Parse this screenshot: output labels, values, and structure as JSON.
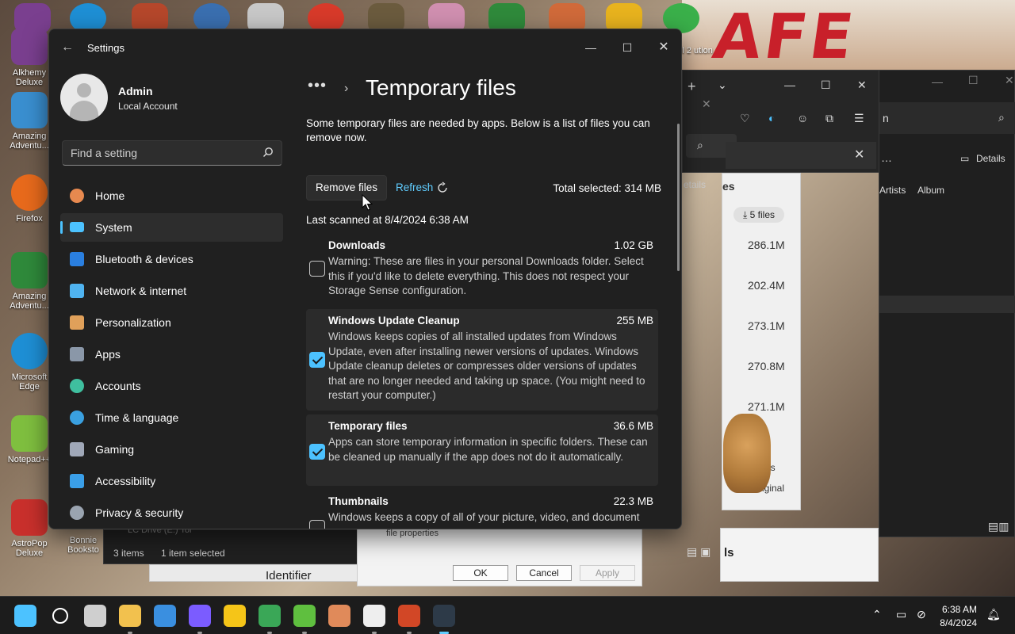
{
  "desktop": {
    "banner_text": "AFE",
    "icons": [
      {
        "label": "Alkhemy Deluxe",
        "color": "#7a3f8f"
      },
      {
        "label": "Amazing Adventu...",
        "color": "#3a8fd0"
      },
      {
        "label": "Firefox",
        "color": "#e86a1c"
      },
      {
        "label": "Amazing Adventu...",
        "color": "#2f8a3b"
      },
      {
        "label": "Microsoft Edge",
        "color": "#1e8fd5"
      },
      {
        "label": "Notepad++",
        "color": "#7fbf3f"
      },
      {
        "label": "AstroPop Deluxe",
        "color": "#c9302c"
      }
    ],
    "top_partial_label": "rball 2 ution"
  },
  "background_windows": {
    "explorer_status_items": "3 items",
    "explorer_status_selected": "1 item selected",
    "explorer_drive_text": "LC Drive (E:) Tol",
    "explorer_left_label": "Bonnie Booksto",
    "identifier_label": "Identifier",
    "file_properties": "file properties",
    "ok_label": "OK",
    "cancel_label": "Cancel",
    "apply_label": "Apply",
    "media_details_label": "Details",
    "media_partial_search": "n",
    "media_artists": "Artists",
    "media_album": "Album",
    "media_files_badge": "5 files",
    "media_sizes": [
      "286.1M",
      "202.4M",
      "273.1M",
      "270.8M",
      "271.1M"
    ],
    "media_partial_es": "es",
    "media_partial_details": "etails",
    "media_partial_original": "iginal",
    "media_partial_ls": "ls"
  },
  "settings": {
    "app_title": "Settings",
    "user": {
      "name": "Admin",
      "type": "Local Account"
    },
    "search_placeholder": "Find a setting",
    "nav": [
      {
        "label": "Home",
        "icon": "home-icon",
        "color": "#e7894f",
        "active": false
      },
      {
        "label": "System",
        "icon": "system-icon",
        "color": "#4cc2ff",
        "active": true
      },
      {
        "label": "Bluetooth & devices",
        "icon": "bluetooth-icon",
        "color": "#2a7fe0",
        "active": false
      },
      {
        "label": "Network & internet",
        "icon": "network-icon",
        "color": "#4fb3f0",
        "active": false
      },
      {
        "label": "Personalization",
        "icon": "personalization-icon",
        "color": "#e0a05a",
        "active": false
      },
      {
        "label": "Apps",
        "icon": "apps-icon",
        "color": "#8a97a8",
        "active": false
      },
      {
        "label": "Accounts",
        "icon": "accounts-icon",
        "color": "#3fbf9f",
        "active": false
      },
      {
        "label": "Time & language",
        "icon": "time-language-icon",
        "color": "#3aa0e0",
        "active": false
      },
      {
        "label": "Gaming",
        "icon": "gaming-icon",
        "color": "#a0a8b8",
        "active": false
      },
      {
        "label": "Accessibility",
        "icon": "accessibility-icon",
        "color": "#3a9fe8",
        "active": false
      },
      {
        "label": "Privacy & security",
        "icon": "shield-icon",
        "color": "#9aa4b0",
        "active": false
      }
    ],
    "breadcrumb_more": "•••",
    "page_title": "Temporary files",
    "intro": "Some temporary files are needed by apps. Below is a list of files you can remove now.",
    "remove_files_label": "Remove files",
    "refresh_label": "Refresh",
    "total_selected": "Total selected: 314 MB",
    "last_scanned": "Last scanned at 8/4/2024 6:38 AM",
    "files": [
      {
        "name": "Downloads",
        "size": "1.02 GB",
        "checked": false,
        "desc": "Warning: These are files in your personal Downloads folder. Select this if you'd like to delete everything. This does not respect your Storage Sense configuration."
      },
      {
        "name": "Windows Update Cleanup",
        "size": "255 MB",
        "checked": true,
        "desc": "Windows keeps copies of all installed updates from Windows Update, even after installing newer versions of updates. Windows Update cleanup deletes or compresses older versions of updates that are no longer needed and taking up space. (You might need to restart your computer.)"
      },
      {
        "name": "Temporary files",
        "size": "36.6 MB",
        "checked": true,
        "desc": "Apps can store temporary information in specific folders. These can be cleaned up manually if the app does not do it automatically."
      },
      {
        "name": "Thumbnails",
        "size": "22.3 MB",
        "checked": false,
        "desc": "Windows keeps a copy of all of your picture, video, and document"
      }
    ]
  },
  "taskbar": {
    "apps": [
      {
        "name": "start-icon",
        "color": "#4cc2ff"
      },
      {
        "name": "search-icon",
        "color": "#ffffff"
      },
      {
        "name": "task-view-icon",
        "color": "#cfcfcf"
      },
      {
        "name": "file-explorer-icon",
        "color": "#f2c14e"
      },
      {
        "name": "microsoft-store-icon",
        "color": "#3a8fe0"
      },
      {
        "name": "firefox-icon",
        "color": "#7b5cff"
      },
      {
        "name": "app-yellow-icon",
        "color": "#f5c518"
      },
      {
        "name": "chrome-icon",
        "color": "#3aa757"
      },
      {
        "name": "app-green-cube-icon",
        "color": "#5fbf3f"
      },
      {
        "name": "app-character-icon",
        "color": "#e08a5a"
      },
      {
        "name": "7zip-icon",
        "color": "#eeeeee"
      },
      {
        "name": "powerpoint-icon",
        "color": "#d24726"
      },
      {
        "name": "settings-gear-icon",
        "color": "#9fb4c8"
      }
    ],
    "time": "6:38 AM",
    "date": "8/4/2024"
  }
}
